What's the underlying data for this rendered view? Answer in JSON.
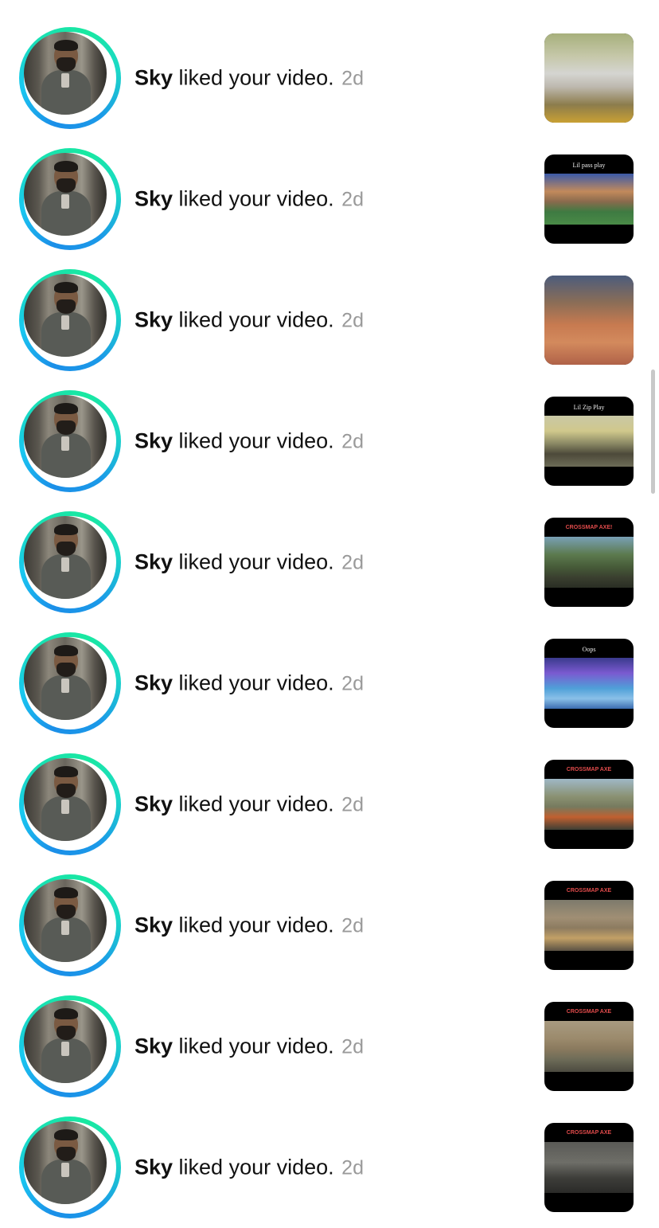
{
  "notifications": [
    {
      "name": "Sky",
      "action": " liked your video.",
      "time": "2d",
      "thumb": {
        "caption": "",
        "style": "full",
        "bg": "linear-gradient(180deg,#a7b07c 0%,#c5c7a8 25%,#d5d5d1 45%,#bdb8ae 60%,#8c7c4c 80%,#c9a034 100%)"
      }
    },
    {
      "name": "Sky",
      "action": " liked your video.",
      "time": "2d",
      "thumb": {
        "caption": "Lil pass play",
        "style": "letterbox",
        "bg": "linear-gradient(180deg,#3b5aa8 0%,#c28a5c 35%,#8a6a4d 55%,#3e7a42 75%,#4a8a47 100%)"
      }
    },
    {
      "name": "Sky",
      "action": " liked your video.",
      "time": "2d",
      "thumb": {
        "caption": "",
        "style": "full",
        "bg": "linear-gradient(180deg,#4c5c7c 0%,#8a6d57 30%,#c77a50 55%,#d38a5d 75%,#b06248 100%)"
      }
    },
    {
      "name": "Sky",
      "action": " liked your video.",
      "time": "2d",
      "thumb": {
        "caption": "Lil Zip Play",
        "style": "letterbox",
        "bg": "linear-gradient(180deg,#c9c8a6 0%,#d0c88c 30%,#8a8864 55%,#4d4a3a 75%,#6c6b56 100%)"
      }
    },
    {
      "name": "Sky",
      "action": " liked your video.",
      "time": "2d",
      "thumb": {
        "caption": "CROSSMAP AXE!",
        "style": "letterbox-red",
        "bg": "linear-gradient(180deg,#79a0b6 0%,#5c7a4e 35%,#465a38 60%,#3a3f2f 80%,#2a2e24 100%)"
      }
    },
    {
      "name": "Sky",
      "action": " liked your video.",
      "time": "2d",
      "thumb": {
        "caption": "Oops",
        "style": "letterbox",
        "bg": "linear-gradient(180deg,#3a3a8c 0%,#7a5ad0 30%,#4fa0d8 60%,#8ac0e8 80%,#3c6cb0 100%)"
      }
    },
    {
      "name": "Sky",
      "action": " liked your video.",
      "time": "2d",
      "thumb": {
        "caption": "CROSSMAP AXE",
        "style": "letterbox-red",
        "bg": "linear-gradient(180deg,#9fb8c6 0%,#8a9172 35%,#767a5e 55%,#c06030 75%,#3d3f35 100%)"
      }
    },
    {
      "name": "Sky",
      "action": " liked your video.",
      "time": "2d",
      "thumb": {
        "caption": "CROSSMAP AXE",
        "style": "letterbox-red",
        "bg": "linear-gradient(180deg,#7d7a6c 0%,#a08f74 35%,#8c7b60 55%,#c2a066 75%,#5b5244 100%)"
      }
    },
    {
      "name": "Sky",
      "action": " liked your video.",
      "time": "2d",
      "thumb": {
        "caption": "CROSSMAP AXE",
        "style": "letterbox-red",
        "bg": "linear-gradient(180deg,#a89a80 0%,#9b8a6c 35%,#8a7a5e 55%,#6e6c58 75%,#4c4b40 100%)"
      }
    },
    {
      "name": "Sky",
      "action": " liked your video.",
      "time": "2d",
      "thumb": {
        "caption": "CROSSMAP AXE",
        "style": "letterbox-red",
        "bg": "linear-gradient(180deg,#5a5a56 0%,#6e6e68 40%,#3e3e3a 70%,#2a2a28 100%)"
      }
    }
  ],
  "colors": {
    "ring_start": "#1b8fe8",
    "ring_end": "#19e8a0",
    "time_gray": "#9a9a9a",
    "scrollbar": "#c8c8c8"
  }
}
